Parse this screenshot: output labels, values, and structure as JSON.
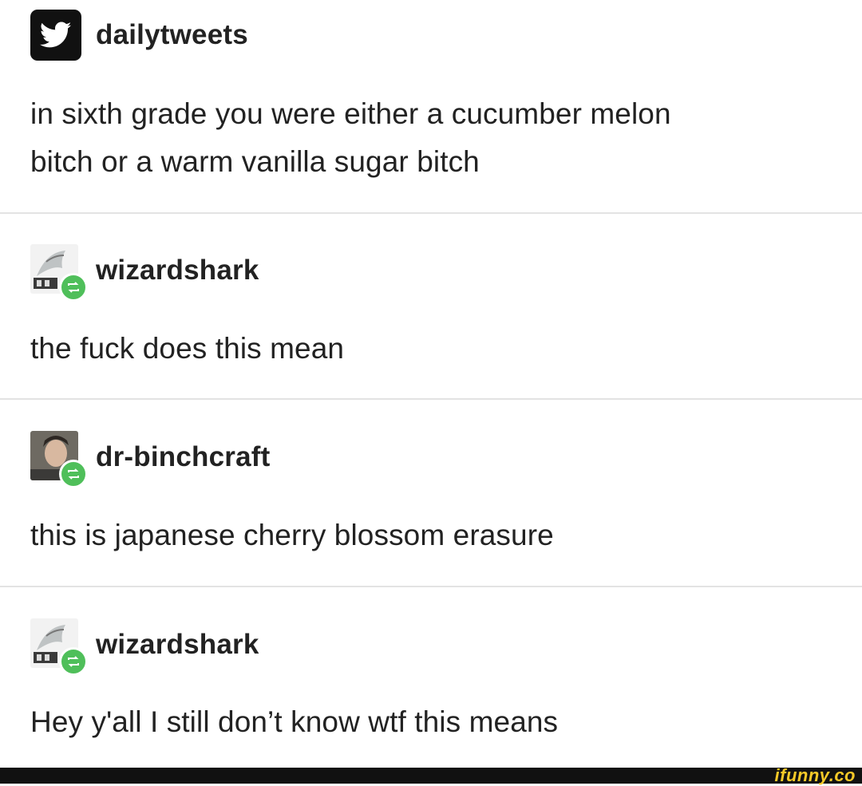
{
  "posts": [
    {
      "username": "dailytweets",
      "text": [
        "in sixth grade you were either a cucumber melon",
        "bitch or a warm vanilla sugar bitch"
      ],
      "icon": "twitter-icon"
    },
    {
      "username": "wizardshark",
      "text": [
        "the fuck does this mean"
      ],
      "icon": "shark-avatar"
    },
    {
      "username": "dr-binchcraft",
      "text": [
        "this is japanese cherry blossom erasure"
      ],
      "icon": "person-avatar"
    },
    {
      "username": "wizardshark",
      "text": [
        "Hey y'all I still don’t know wtf this means"
      ],
      "icon": "shark-avatar"
    }
  ],
  "watermark": "ifunny.co",
  "colors": {
    "reblog": "#4fbf5a",
    "divider": "#e3e3e3",
    "watermark": "#f7c928"
  }
}
